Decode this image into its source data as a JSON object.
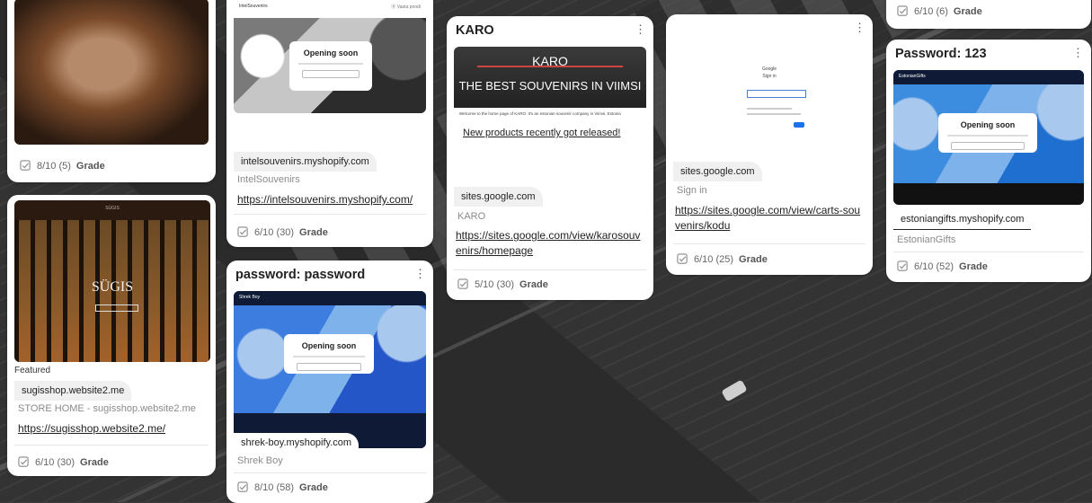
{
  "cards": [
    {
      "id": "c1",
      "grade_score": "8/10 (5)",
      "grade_label": "Grade"
    },
    {
      "id": "c2",
      "header_left": "IntelSouvenirs",
      "header_right": "Ⓡ Vaata poodi",
      "opening_text": "Opening soon",
      "domain": "intelsouvenirs.myshopify.com",
      "site_title": "IntelSouvenirs",
      "link": "https://intelsouvenirs.myshopify.com/",
      "grade_score": "6/10 (30)",
      "grade_label": "Grade"
    },
    {
      "id": "c3",
      "title": "KARO",
      "banner_top": "KARO",
      "banner_bottom": "THE BEST SOUVENIRS IN VIIMSI",
      "welcome_text": "Welcome to the home page of KARO. It's an estonian souvenir company in Viimsi, Estonia",
      "announcement": "New products recently got released!",
      "domain": "sites.google.com",
      "site_title": "KARO",
      "link": "https://sites.google.com/view/karosouvenirs/homepage",
      "grade_score": "5/10 (30)",
      "grade_label": "Grade"
    },
    {
      "id": "c4",
      "google_title": "Google",
      "google_sub": "Sign in",
      "domain": "sites.google.com",
      "site_title": "Sign in",
      "link": "https://sites.google.com/view/carts-souvenirs/kodu",
      "grade_score": "6/10 (25)",
      "grade_label": "Grade"
    },
    {
      "id": "c5",
      "grade_score": "6/10 (6)",
      "grade_label": "Grade"
    },
    {
      "id": "c6",
      "title": "Password: 123",
      "header_left": "EstonianGifts",
      "opening_text": "Opening soon",
      "domain": "estoniangifts.myshopify.com",
      "site_title": "EstonianGifts",
      "grade_score": "6/10 (52)",
      "grade_label": "Grade"
    },
    {
      "id": "c7",
      "header_text": "SÜGIS",
      "hero_text": "SÜGIS",
      "badge": "Featured",
      "domain": "sugisshop.website2.me",
      "site_title": "STORE HOME - sugisshop.website2.me",
      "link": "https://sugisshop.website2.me/",
      "grade_score": "6/10 (30)",
      "grade_label": "Grade"
    },
    {
      "id": "c8",
      "title": "password: password",
      "header_left": "Shrek Boy",
      "opening_text": "Opening soon",
      "domain": "shrek-boy.myshopify.com",
      "site_title": "Shrek Boy",
      "grade_score": "8/10 (58)",
      "grade_label": "Grade"
    }
  ],
  "icons": {
    "kebab": "⋮",
    "check": "check-square-icon"
  }
}
